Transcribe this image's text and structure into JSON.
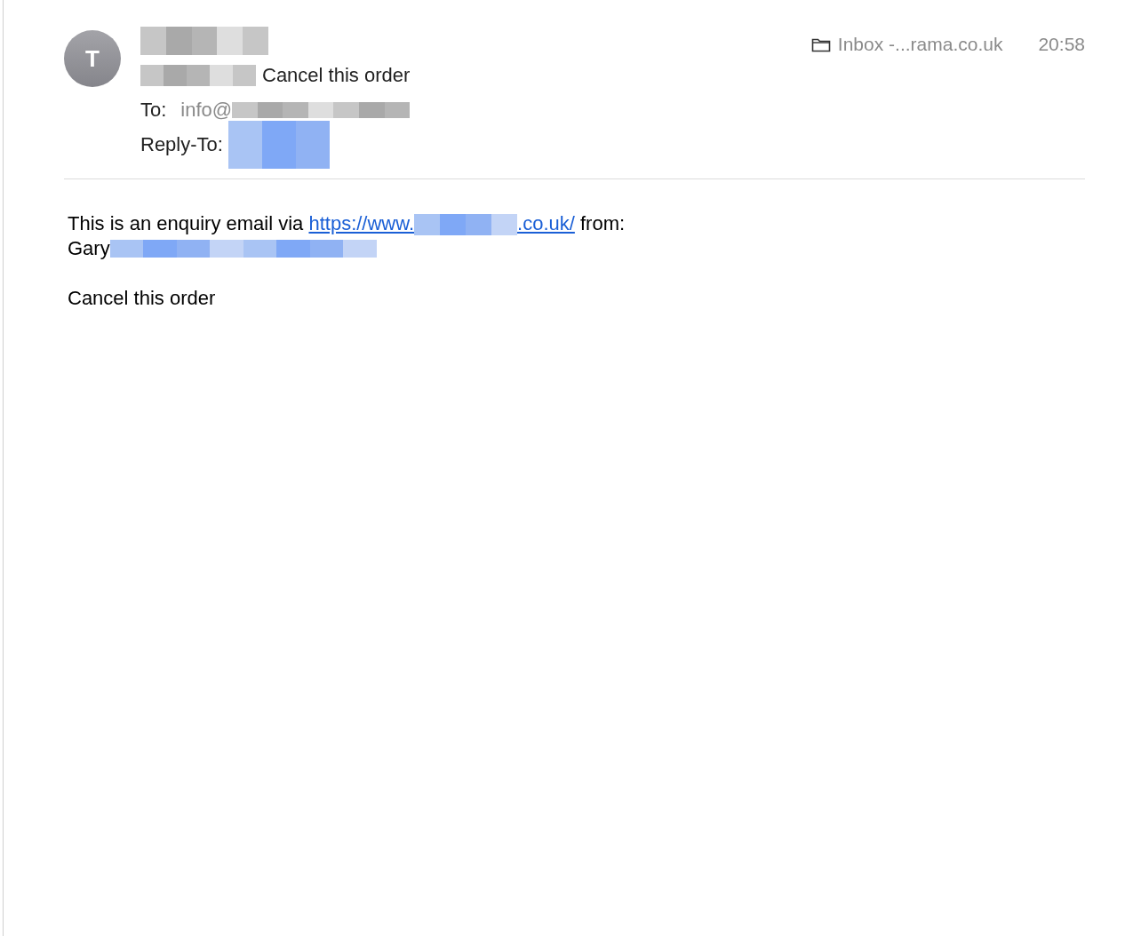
{
  "message": {
    "avatar_initial": "T",
    "subject": "Cancel this order",
    "to_label": "To:",
    "to_value": "info@",
    "reply_to_label": "Reply-To:",
    "folder": "Inbox -...rama.co.uk",
    "time": "20:58"
  },
  "body": {
    "intro_before": "This is an enquiry email via ",
    "link_start": "https://www.",
    "link_end": ".co.uk/",
    "intro_after": " from:",
    "sender_name": "Gary",
    "text": "Cancel this order"
  }
}
